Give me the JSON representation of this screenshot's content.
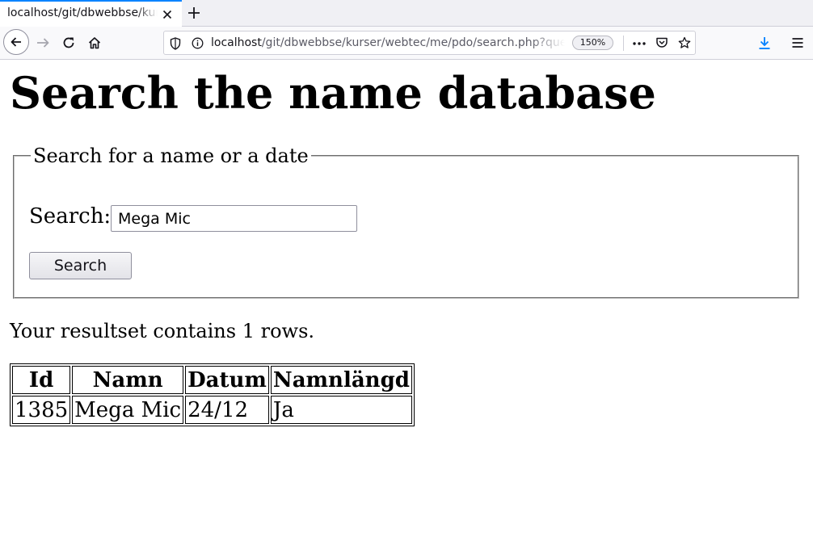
{
  "browser": {
    "tab_title": "localhost/git/dbwebbse/kurser/webtec/me/pdo/search.php?query=Mega+Mic",
    "url_host": "localhost",
    "url_path": "/git/dbwebbse/kurser/webtec/me/pdo/search.php?query=Mega+Mic",
    "zoom": "150%",
    "accent_color": "#0a84ff"
  },
  "page": {
    "heading": "Search the name database",
    "fieldset_legend": "Search for a name or a date",
    "search_label": "Search:",
    "search_value": "Mega Mic",
    "search_button": "Search",
    "result_text": "Your resultset contains 1 rows.",
    "table": {
      "columns": [
        "Id",
        "Namn",
        "Datum",
        "Namnlängd"
      ],
      "rows": [
        [
          "1385",
          "Mega Mic",
          "24/12",
          "Ja"
        ]
      ]
    }
  }
}
